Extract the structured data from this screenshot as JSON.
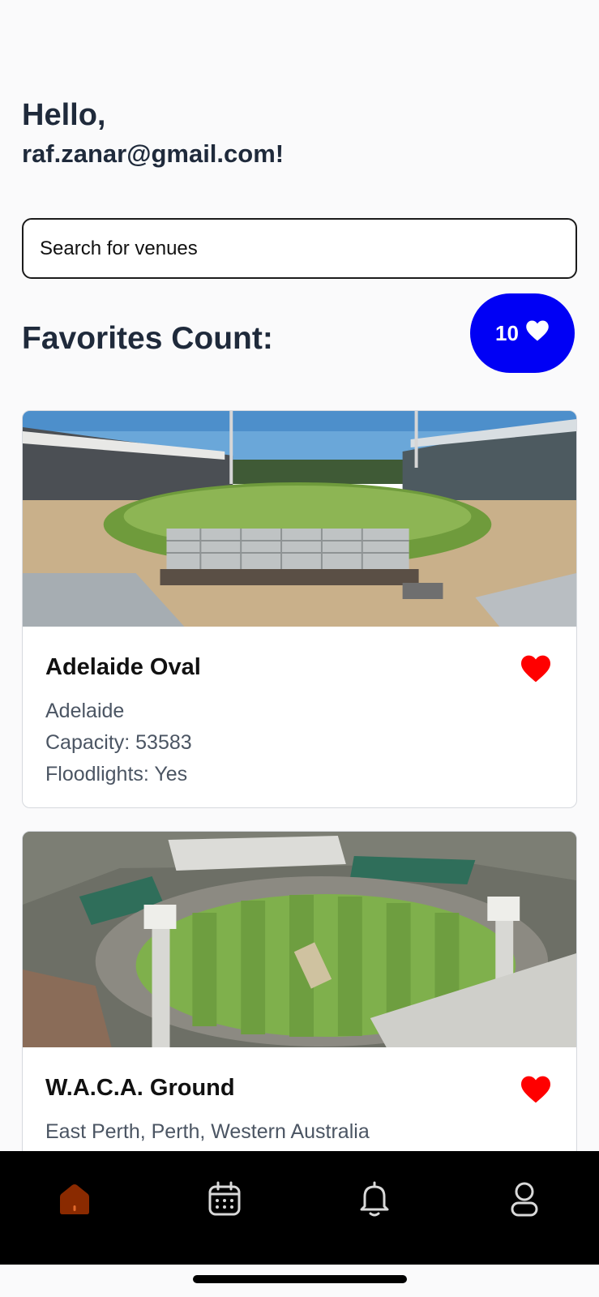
{
  "greeting": {
    "hello": "Hello,",
    "email": "raf.zanar@gmail.com!"
  },
  "search": {
    "placeholder": "Search for venues",
    "value": ""
  },
  "favorites": {
    "label": "Favorites Count:",
    "count": "10"
  },
  "venues": [
    {
      "name": "Adelaide Oval",
      "location": "Adelaide",
      "capacity": "Capacity: 53583",
      "floodlights": "Floodlights: Yes",
      "favorited": true
    },
    {
      "name": "W.A.C.A. Ground",
      "location": "East Perth,  Perth, Western Australia",
      "favorited": true
    }
  ],
  "tabs": [
    {
      "name": "home",
      "icon": "home-icon",
      "active": true
    },
    {
      "name": "calendar",
      "icon": "calendar-icon",
      "active": false
    },
    {
      "name": "notifications",
      "icon": "bell-icon",
      "active": false
    },
    {
      "name": "profile",
      "icon": "user-icon",
      "active": false
    }
  ],
  "colors": {
    "accent": "#0000f5",
    "heart": "#ff0000",
    "active_tab": "#8a2a00",
    "text_dark": "#1f2a3b"
  }
}
